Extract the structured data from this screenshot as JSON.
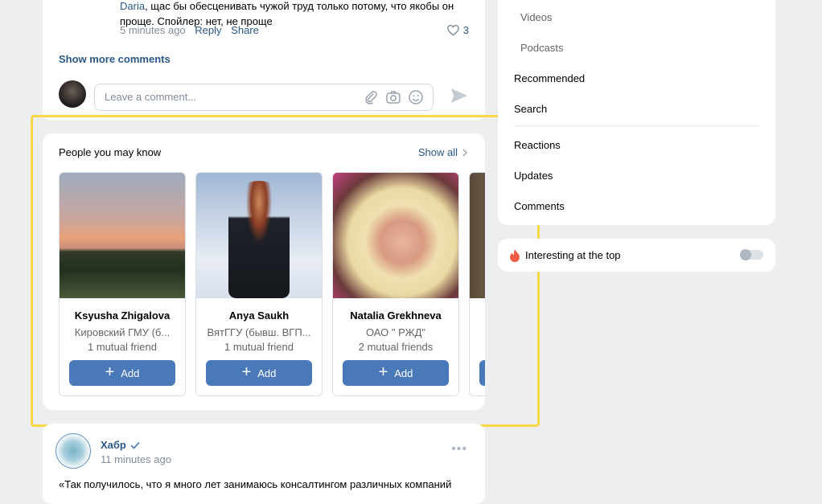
{
  "comment": {
    "text_prefix": "Daria",
    "text": ", щас бы обесценивать чужой труд только потому, что якобы он проще. Спойлер: нет, не проще",
    "time": "5 minutes ago",
    "reply": "Reply",
    "share": "Share",
    "likes": "3",
    "show_more": "Show more comments",
    "input_placeholder": "Leave a comment..."
  },
  "people": {
    "title": "People you may know",
    "show_all": "Show all",
    "add_label": "Add",
    "items": [
      {
        "name": "Ksyusha Zhigalova",
        "uni": "Кировский ГМУ (б...",
        "mutual": "1 mutual friend"
      },
      {
        "name": "Anya Saukh",
        "uni": "ВятГГУ (бывш. ВГП...",
        "mutual": "1 mutual friend"
      },
      {
        "name": "Natalia Grekhneva",
        "uni": "ОАО \" РЖД\"",
        "mutual": "2 mutual friends"
      }
    ]
  },
  "post": {
    "author": "Хабр",
    "time": "11 minutes ago",
    "text": "«Так получилось, что я много лет занимаюсь консалтингом различных компаний"
  },
  "sidebar": {
    "videos": "Videos",
    "podcasts": "Podcasts",
    "recommended": "Recommended",
    "search": "Search",
    "reactions": "Reactions",
    "updates": "Updates",
    "comments": "Comments",
    "interesting": "Interesting at the top"
  },
  "colors": {
    "accent": "#4a79ba",
    "highlight": "#f7d74a",
    "link": "#2a5885"
  }
}
